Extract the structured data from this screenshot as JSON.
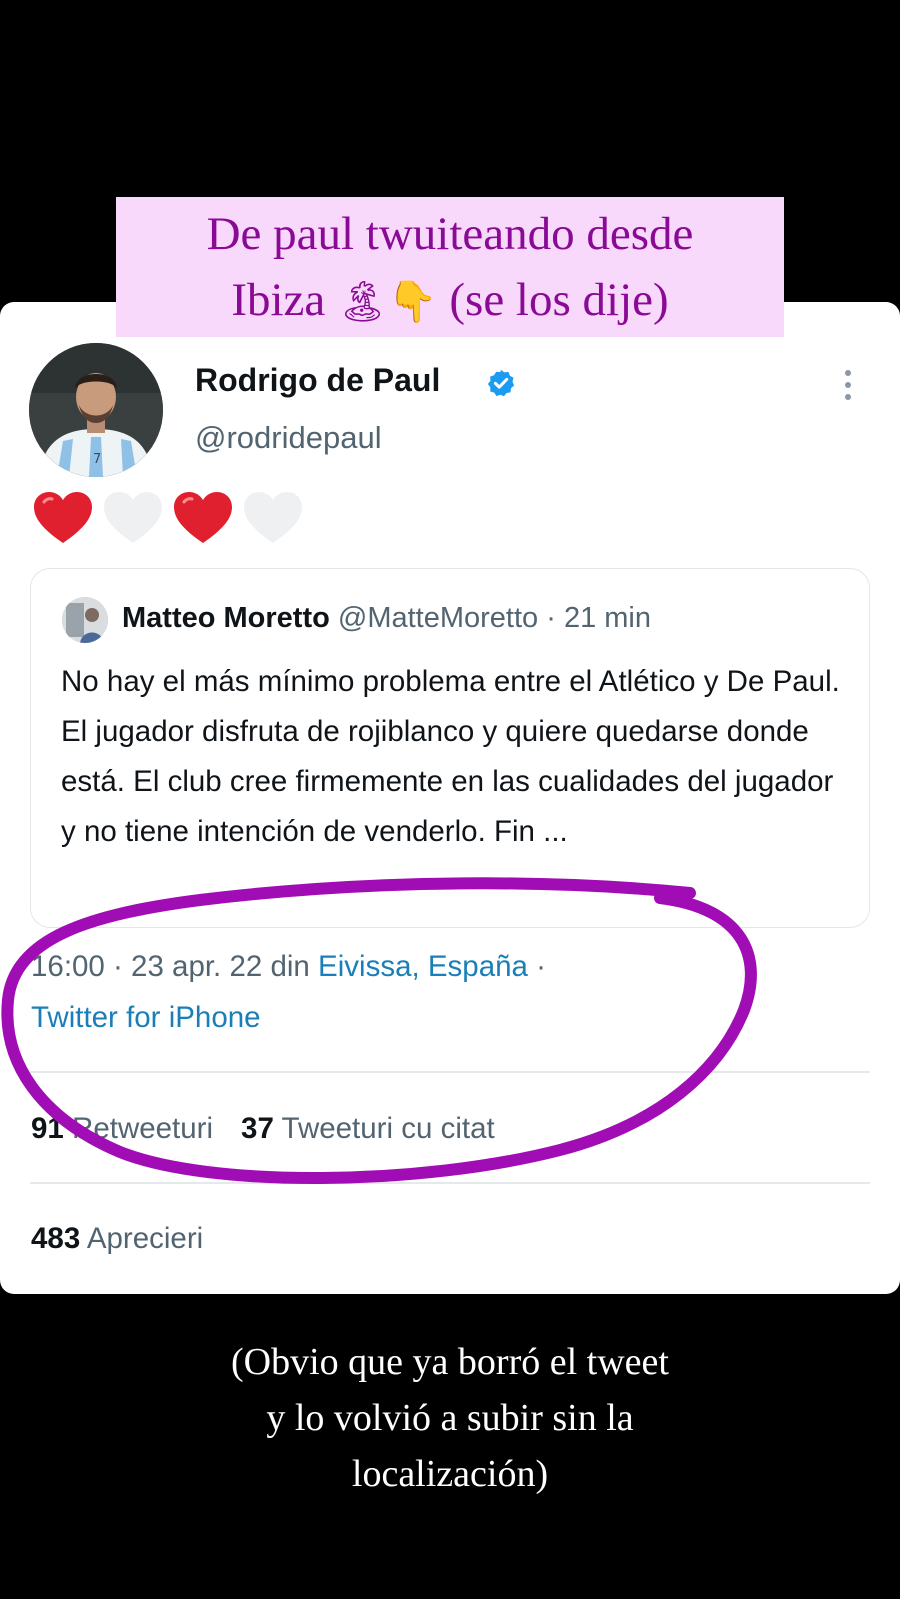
{
  "story": {
    "top_caption": {
      "line1": "De paul twuiteando desde",
      "line2_text": "Ibiza",
      "line2_emoji": "🏝👇",
      "line2_end": "(se los dije)"
    },
    "bottom_caption": {
      "line1": "(Obvio que ya borró el tweet",
      "line2": "y lo volvió a subir sin la",
      "line3": "localización)"
    },
    "annotation_color": "#a10db5"
  },
  "tweet": {
    "author_name": "Rodrigo de Paul",
    "author_handle": "@rodridepaul",
    "verified": true,
    "body_hearts": [
      "red-heart-icon",
      "white-heart-icon",
      "red-heart-icon",
      "white-heart-icon"
    ],
    "quoted": {
      "name": "Matteo Moretto",
      "handle": "@MatteMoretto",
      "time": "· 21 min",
      "text": "No hay el más mínimo problema entre el Atlético y De Paul. El jugador disfruta de rojiblanco y quiere quedarse donde está. El club cree firmemente en las cualidades del jugador y no tiene intención de venderlo. Fin ..."
    },
    "meta": {
      "time_date": "16:00 · 23 apr. 22 din",
      "location": "Eivissa, España",
      "separator": "·",
      "source": "Twitter for iPhone"
    },
    "stats": {
      "retweets_count": "91",
      "retweets_label": "Retweeturi",
      "quotes_count": "37",
      "quotes_label": "Tweeturi cu citat",
      "likes_count": "483",
      "likes_label": "Aprecieri"
    },
    "colors": {
      "link": "#1a7fb8",
      "verified": "#1d9bf0",
      "heart_red": "#e0202e"
    }
  }
}
